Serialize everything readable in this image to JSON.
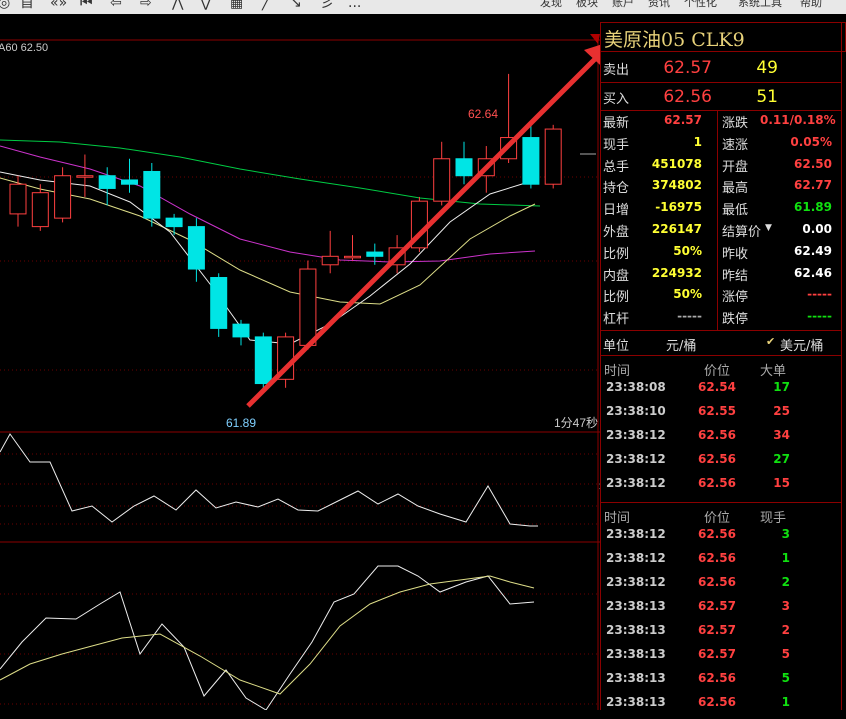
{
  "toolbar": {
    "icons": [
      "◎",
      "首",
      "«»",
      "⏮",
      "⇦",
      "⇨",
      "⋀",
      "⋁",
      "▦",
      "╱",
      "↘",
      "彡",
      "..."
    ],
    "menus": [
      "发现",
      "板块",
      "账户",
      "资讯",
      "个性化",
      "系统工具",
      "帮助"
    ]
  },
  "chart": {
    "ma_label": "A60 62.50",
    "high_label": "62.64",
    "low_label": "61.89",
    "timer": "1分47秒",
    "candles": [
      {
        "o": 62.31,
        "c": 62.38,
        "h": 62.4,
        "l": 62.28
      },
      {
        "o": 62.28,
        "c": 62.36,
        "h": 62.38,
        "l": 62.27
      },
      {
        "o": 62.3,
        "c": 62.4,
        "h": 62.42,
        "l": 62.29
      },
      {
        "o": 62.4,
        "c": 62.4,
        "h": 62.45,
        "l": 62.35
      },
      {
        "o": 62.4,
        "c": 62.37,
        "h": 62.42,
        "l": 62.33
      },
      {
        "o": 62.39,
        "c": 62.38,
        "h": 62.44,
        "l": 62.36
      },
      {
        "o": 62.41,
        "c": 62.3,
        "h": 62.43,
        "l": 62.28
      },
      {
        "o": 62.3,
        "c": 62.28,
        "h": 62.31,
        "l": 62.26
      },
      {
        "o": 62.28,
        "c": 62.18,
        "h": 62.3,
        "l": 62.15
      },
      {
        "o": 62.16,
        "c": 62.04,
        "h": 62.17,
        "l": 62.02
      },
      {
        "o": 62.05,
        "c": 62.02,
        "h": 62.06,
        "l": 62.0
      },
      {
        "o": 62.02,
        "c": 61.91,
        "h": 62.03,
        "l": 61.89
      },
      {
        "o": 61.92,
        "c": 62.02,
        "h": 62.03,
        "l": 61.9
      },
      {
        "o": 62.0,
        "c": 62.18,
        "h": 62.2,
        "l": 61.99
      },
      {
        "o": 62.19,
        "c": 62.21,
        "h": 62.27,
        "l": 62.17
      },
      {
        "o": 62.21,
        "c": 62.21,
        "h": 62.26,
        "l": 62.2
      },
      {
        "o": 62.22,
        "c": 62.21,
        "h": 62.24,
        "l": 62.19
      },
      {
        "o": 62.19,
        "c": 62.23,
        "h": 62.26,
        "l": 62.17
      },
      {
        "o": 62.23,
        "c": 62.34,
        "h": 62.35,
        "l": 62.22
      },
      {
        "o": 62.34,
        "c": 62.44,
        "h": 62.48,
        "l": 62.33
      },
      {
        "o": 62.44,
        "c": 62.4,
        "h": 62.48,
        "l": 62.38
      },
      {
        "o": 62.4,
        "c": 62.44,
        "h": 62.47,
        "l": 62.36
      },
      {
        "o": 62.44,
        "c": 62.49,
        "h": 62.64,
        "l": 62.43
      },
      {
        "o": 62.49,
        "c": 62.38,
        "h": 62.52,
        "l": 62.37
      },
      {
        "o": 62.38,
        "c": 62.51,
        "h": 62.52,
        "l": 62.37
      }
    ]
  },
  "quote": {
    "title": "美原油05  CLK9",
    "sell_label": "卖出",
    "sell_price": "62.57",
    "sell_vol": "49",
    "buy_label": "买入",
    "buy_price": "62.56",
    "buy_vol": "51",
    "left": [
      {
        "label": "最新",
        "value": "62.57",
        "color": "red"
      },
      {
        "label": "现手",
        "value": "1",
        "color": "yellow"
      },
      {
        "label": "总手",
        "value": "451078",
        "color": "yellow"
      },
      {
        "label": "持仓",
        "value": "374802",
        "color": "yellow"
      },
      {
        "label": "日增",
        "value": "-16975",
        "color": "yellow"
      },
      {
        "label": "外盘",
        "value": "226147",
        "color": "yellow"
      },
      {
        "label": "比例",
        "value": "50%",
        "color": "yellow"
      },
      {
        "label": "内盘",
        "value": "224932",
        "color": "yellow"
      },
      {
        "label": "比例",
        "value": "50%",
        "color": "yellow"
      },
      {
        "label": "杠杆",
        "value": "-----",
        "color": "grey"
      }
    ],
    "right": [
      {
        "label": "涨跌",
        "value": "0.11/0.18%",
        "color": "red"
      },
      {
        "label": "速涨",
        "value": "0.05%",
        "color": "red"
      },
      {
        "label": "开盘",
        "value": "62.50",
        "color": "red"
      },
      {
        "label": "最高",
        "value": "62.77",
        "color": "red"
      },
      {
        "label": "最低",
        "value": "61.89",
        "color": "green"
      },
      {
        "label": "结算价",
        "value": "0.00",
        "color": "white"
      },
      {
        "label": "昨收",
        "value": "62.49",
        "color": "white"
      },
      {
        "label": "昨结",
        "value": "62.46",
        "color": "white"
      },
      {
        "label": "涨停",
        "value": "-----",
        "color": "red"
      },
      {
        "label": "跌停",
        "value": "-----",
        "color": "green"
      }
    ],
    "unit_label": "单位",
    "unit_value": "元/桶",
    "currency": "美元/桶"
  },
  "trades_big": {
    "headers": [
      "时间",
      "价位",
      "大单"
    ],
    "rows": [
      {
        "time": "23:38:08",
        "price": "62.54",
        "vol": "17",
        "color": "green"
      },
      {
        "time": "23:38:10",
        "price": "62.55",
        "vol": "25",
        "color": "red"
      },
      {
        "time": "23:38:12",
        "price": "62.56",
        "vol": "34",
        "color": "red"
      },
      {
        "time": "23:38:12",
        "price": "62.56",
        "vol": "27",
        "color": "green"
      },
      {
        "time": "23:38:12",
        "price": "62.56",
        "vol": "15",
        "color": "red"
      }
    ]
  },
  "trades_tick": {
    "headers": [
      "时间",
      "价位",
      "现手"
    ],
    "rows": [
      {
        "time": "23:38:12",
        "price": "62.56",
        "vol": "3",
        "color": "green"
      },
      {
        "time": "23:38:12",
        "price": "62.56",
        "vol": "1",
        "color": "green"
      },
      {
        "time": "23:38:12",
        "price": "62.56",
        "vol": "2",
        "color": "green"
      },
      {
        "time": "23:38:13",
        "price": "62.57",
        "vol": "3",
        "color": "red"
      },
      {
        "time": "23:38:13",
        "price": "62.57",
        "vol": "2",
        "color": "red"
      },
      {
        "time": "23:38:13",
        "price": "62.57",
        "vol": "5",
        "color": "red"
      },
      {
        "time": "23:38:13",
        "price": "62.56",
        "vol": "5",
        "color": "green"
      },
      {
        "time": "23:38:13",
        "price": "62.56",
        "vol": "1",
        "color": "green"
      }
    ]
  }
}
